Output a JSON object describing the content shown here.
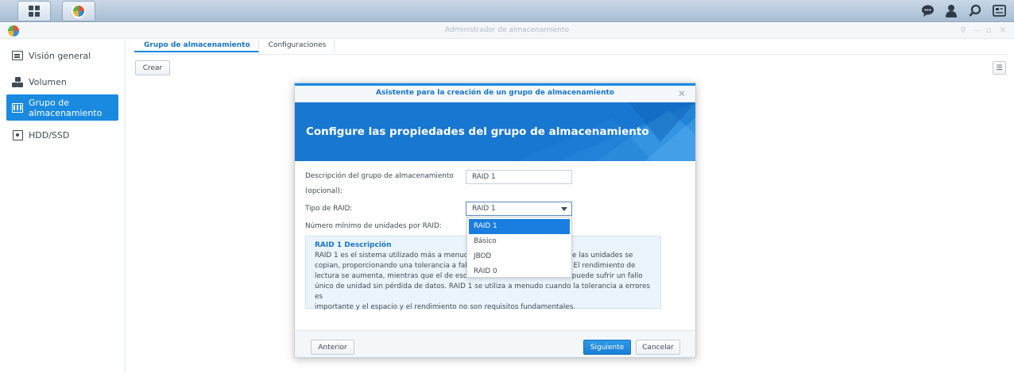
{
  "taskbar": {
    "main_menu_icon": "grid-icon",
    "app_icon": "storage-manager-icon",
    "right_icons": [
      "chat-icon",
      "user-icon",
      "search-icon",
      "widgets-icon"
    ]
  },
  "window": {
    "title": "Administrador de almacenamiento",
    "controls": [
      "pin-icon",
      "minimize-icon",
      "maximize-icon",
      "close-icon"
    ]
  },
  "sidebar": {
    "items": [
      {
        "label": "Visión general",
        "icon": "overview-icon"
      },
      {
        "label": "Volumen",
        "icon": "volume-icon"
      },
      {
        "label": "Grupo de almacenamiento",
        "icon": "storage-pool-icon",
        "active": true
      },
      {
        "label": "HDD/SSD",
        "icon": "hdd-icon"
      }
    ]
  },
  "main": {
    "tabs": [
      {
        "label": "Grupo de almacenamiento",
        "active": true
      },
      {
        "label": "Configuraciones"
      }
    ],
    "create_label": "Crear"
  },
  "modal": {
    "title": "Asistente para la creación de un grupo de almacenamiento",
    "heading": "Configure las propiedades del grupo de almacenamiento",
    "desc_label_line1": "Descripción del grupo de almacenamiento",
    "desc_label_line2": "(opcional):",
    "desc_value": "RAID 1",
    "raid_label": "Tipo de RAID:",
    "raid_value": "RAID 1",
    "min_units_label": "Número mínimo de unidades por RAID:",
    "raid_options": [
      "RAID 1",
      "Básico",
      "JBOD",
      "RAID 0"
    ],
    "info_title": "RAID 1 Descripción",
    "info_lines": [
      "RAID 1 es el sistema utilizado más a menudo,",
      "copian, proporcionando una tolerancia a fallos",
      "lectura se aumenta, mientras que el de escritu",
      "único de unidad sin pérdida de datos. RAID 1 se utiliza a menudo cuando la tolerancia a errores es",
      "importante y el espacio y el rendimiento no son requisitos fundamentales."
    ],
    "info_right_lines": [
      "e las unidades se",
      "ades. El rendimiento de",
      "Se puede sufrir un fallo"
    ],
    "prev_label": "Anterior",
    "next_label": "Siguiente",
    "cancel_label": "Cancelar"
  },
  "colors": {
    "accent": "#1a8ae0",
    "banner": "#1877d0"
  }
}
